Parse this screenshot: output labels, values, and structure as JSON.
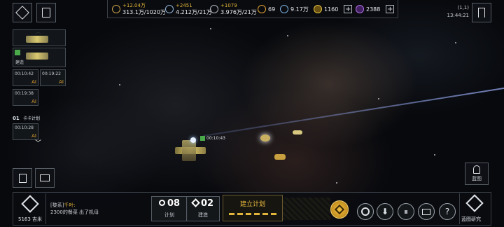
{
  "resources": [
    {
      "name": "metal",
      "gain": "+12.04万",
      "amount": "313.1万/1020万"
    },
    {
      "name": "crystal",
      "gain": "+2451",
      "amount": "4.212万/21万"
    },
    {
      "name": "gas",
      "gain": "+1079",
      "amount": "3.976万/21万"
    }
  ],
  "misc": {
    "value1": "69",
    "value2": "9.17万",
    "value3": "1160",
    "value4": "2388"
  },
  "coords": "(1,1)",
  "clock": "13:44:21",
  "queue": {
    "building_label": "建造",
    "timers": [
      "00:10:42",
      "00:19:22",
      "00:19:38"
    ],
    "plan_index": "01",
    "plan_label": "卡卡计划",
    "plan_timer": "00:10:28",
    "ai_marker": "AI"
  },
  "fleet_timer": "00:10:43",
  "player": {
    "distance": "5163 吉米",
    "tag": "[黎系]",
    "name": "千叶:",
    "message": "2300的餐菜  出了机母"
  },
  "counts": {
    "plan_count": "08",
    "plan_label": "计划",
    "build_count": "02",
    "build_label": "建造"
  },
  "build_plan_title": "建立计划",
  "blueprint_label": "蓝图",
  "blueprint_research_label": "蓝图研究",
  "help_glyph": "?"
}
